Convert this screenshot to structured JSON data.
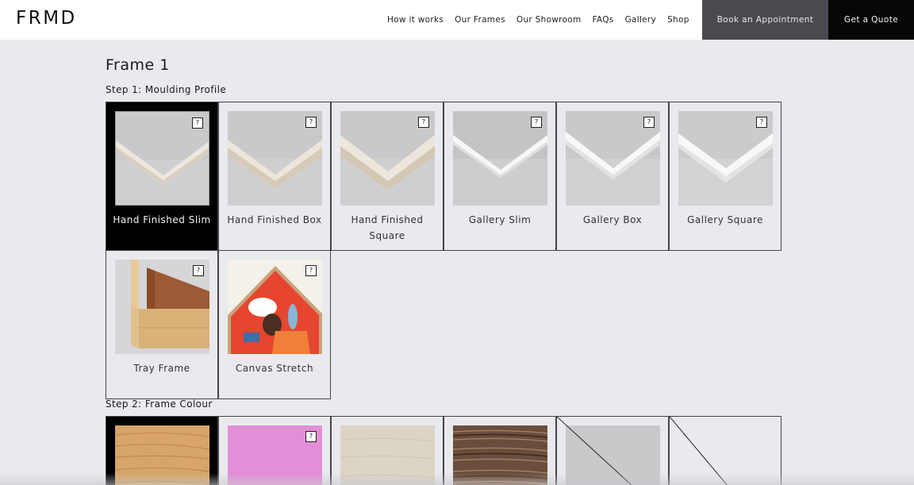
{
  "header": {
    "logo": "FRMD",
    "nav": [
      "How it works",
      "Our Frames",
      "Our Showroom",
      "FAQs",
      "Gallery",
      "Shop"
    ],
    "book_label": "Book an Appointment",
    "quote_label": "Get a Quote"
  },
  "frame_title": "Frame 1",
  "step1": {
    "title": "Step 1: Moulding Profile",
    "help_label": "?",
    "options": [
      {
        "label": "Hand Finished Slim",
        "selected": true
      },
      {
        "label": "Hand Finished Box",
        "selected": false
      },
      {
        "label": "Hand Finished Square",
        "selected": false
      },
      {
        "label": "Gallery Slim",
        "selected": false
      },
      {
        "label": "Gallery Box",
        "selected": false
      },
      {
        "label": "Gallery Square",
        "selected": false
      },
      {
        "label": "Tray Frame",
        "selected": false
      },
      {
        "label": "Canvas Stretch",
        "selected": false
      }
    ]
  },
  "step2": {
    "title": "Step 2: Frame Colour",
    "help_label": "?",
    "swatches": [
      {
        "name": "oak",
        "color": "#d9a86a",
        "selected": true
      },
      {
        "name": "pink",
        "color": "#e38fd8",
        "selected": false
      },
      {
        "name": "limed-oak",
        "color": "#dcd6c8",
        "selected": false
      },
      {
        "name": "walnut",
        "color": "#6a4e3c",
        "selected": false
      },
      {
        "name": "grey",
        "color": "#c8c9cb",
        "selected": false
      },
      {
        "name": "none",
        "color": "#e9eaee",
        "selected": false
      }
    ]
  },
  "colors": {
    "header_bg": "#ffffff",
    "appointment_bg": "#4a4b51",
    "quote_bg": "#070707",
    "page_bg": "#e9eaee",
    "selected_bg": "#000000"
  }
}
